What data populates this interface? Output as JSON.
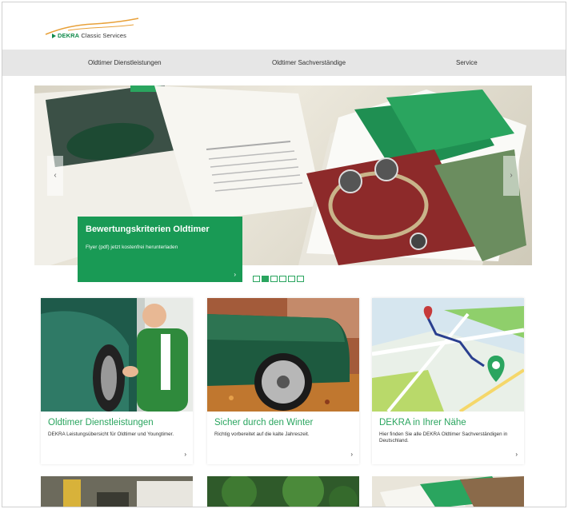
{
  "brand": {
    "prefix": "DEKRA",
    "suffix": " Classic Services",
    "color": "#118a4b"
  },
  "nav": {
    "items": [
      {
        "label": "Oldtimer Dienstleistungen"
      },
      {
        "label": "Oldtimer Sachverständige"
      },
      {
        "label": "Service"
      }
    ]
  },
  "hero": {
    "caption_title": "Bewertungskriterien Oldtimer",
    "caption_subtitle": "Flyer (pdf) jetzt kostenfrei herunterladen",
    "prev_icon": "chevron-left-icon",
    "next_icon": "chevron-right-icon",
    "arrow_prev": "‹",
    "arrow_next": "›",
    "slide_count": 6,
    "active_slide": 2
  },
  "cards": [
    {
      "title": "Oldtimer Dienstleistungen",
      "text": "DEKRA Leistungsübersicht für Oldtimer und Youngtimer.",
      "arrow": "›"
    },
    {
      "title": "Sicher durch den Winter",
      "text": "Richtig vorbereitet auf die kalte Jahreszeit.",
      "arrow": "›"
    },
    {
      "title": "DEKRA in Ihrer Nähe",
      "text": "Hier finden Sie alle DEKRA Oldtimer Sachverständigen in Deutschland.",
      "arrow": "›"
    }
  ],
  "colors": {
    "accent": "#2aa55f",
    "nav_bg": "#e6e6e6",
    "logo_swoosh": "#e8a13a"
  }
}
